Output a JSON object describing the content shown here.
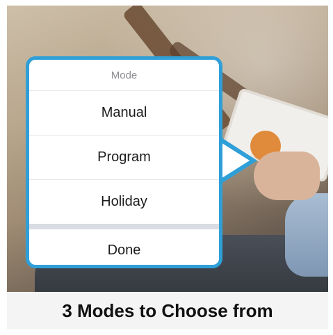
{
  "mode_picker": {
    "title": "Mode",
    "options": [
      "Manual",
      "Program",
      "Holiday"
    ],
    "done_label": "Done"
  },
  "caption": {
    "text": "3 Modes to Choose from"
  },
  "colors": {
    "accent_border": "#2f9fd8",
    "caption_background": "#f4f4f4"
  }
}
